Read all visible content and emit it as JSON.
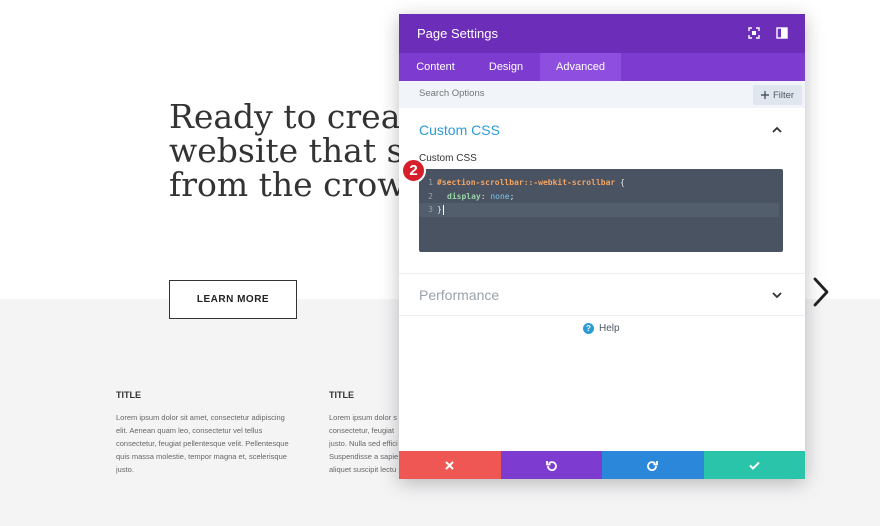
{
  "page": {
    "hero_heading_lines": [
      "Ready to create a",
      "website that stands",
      "from the crowd?"
    ],
    "learn_more_label": "LEARN MORE",
    "columns": [
      {
        "title": "TITLE",
        "text": "Lorem ipsum dolor sit amet, consectetur adipiscing elit. Aenean quam leo, consectetur vel tellus consectetur, feugiat pellentesque velit. Pellentesque quis massa molestie, tempor magna et, scelerisque justo."
      },
      {
        "title": "TITLE",
        "text": "Lorem ipsum dolor s consectetur, feugiat justo. Nulla sed effici Suspendisse a sapie aliquet suscipit lectu"
      }
    ],
    "next_arrow_icon": "chevron-right-icon"
  },
  "modal": {
    "title": "Page Settings",
    "header_icons": [
      "expand-icon",
      "sidebar-toggle-icon"
    ],
    "tabs": [
      {
        "label": "Content",
        "active": false
      },
      {
        "label": "Design",
        "active": false
      },
      {
        "label": "Advanced",
        "active": true
      }
    ],
    "search": {
      "placeholder": "Search Options",
      "value": ""
    },
    "filter_label": "Filter",
    "custom_css": {
      "section_title": "Custom CSS",
      "field_label": "Custom CSS",
      "code_lines": [
        {
          "num": "1",
          "selector": "#section-scrollbar::-webkit-scrollbar",
          "brace": " {"
        },
        {
          "num": "2",
          "property": "display",
          "colon": ": ",
          "value": "none",
          "semi": ";"
        },
        {
          "num": "3",
          "close": "}"
        }
      ]
    },
    "performance": {
      "section_title": "Performance"
    },
    "help_label": "Help",
    "footer_actions": [
      "cancel-icon",
      "undo-icon",
      "redo-icon",
      "save-check-icon"
    ],
    "colors": {
      "header": "#6c2eb9",
      "tabs": "#7d3bcf",
      "accent_blue": "#2c9bd6",
      "cancel": "#ef5755",
      "undo": "#7d3bcf",
      "redo": "#2b87da",
      "save": "#29c4a9"
    }
  },
  "annotation_badge": "2"
}
